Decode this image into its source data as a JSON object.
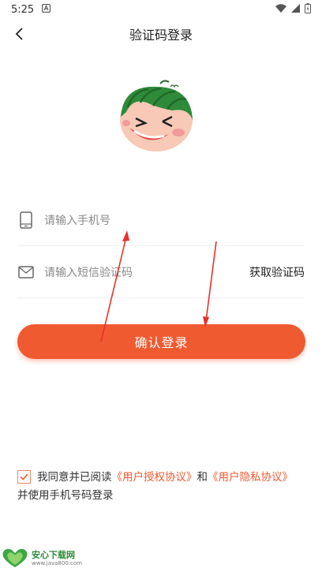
{
  "status_bar": {
    "time": "5:25"
  },
  "nav": {
    "title": "验证码登录"
  },
  "form": {
    "phone_placeholder": "请输入手机号",
    "code_placeholder": "请输入短信验证码",
    "get_code_label": "获取验证码"
  },
  "login_button": {
    "label": "确认登录"
  },
  "agreement": {
    "text_1": "我同意并已阅读",
    "user_agreement": "《用户授权协议》",
    "and": "和",
    "privacy_agreement": "《用户隐私协议》",
    "text_2": "并使用手机号码登录"
  },
  "watermark": {
    "name": "安心下载网",
    "url": "www.java800.com"
  },
  "colors": {
    "accent": "#f05a31",
    "arrow": "#e8312a"
  }
}
